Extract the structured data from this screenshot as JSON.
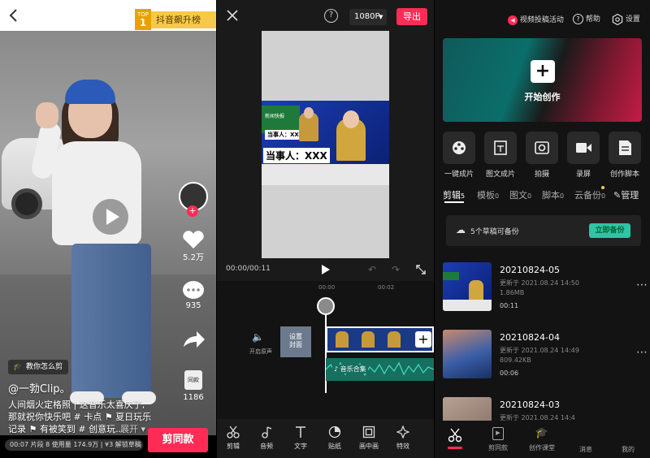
{
  "panel1": {
    "rank_badge": "抖音飙升榜",
    "rank_top": "TOP",
    "rank_number": "1",
    "likes": "5.2万",
    "comments": "935",
    "same_count": "1186",
    "same_label": "同款",
    "tutorial": "教你怎么剪",
    "author": "@一勃Clip。",
    "caption_line1": "人间烟火定格照 | 这音乐太喜庆了,",
    "caption_line2": "那就祝你快乐吧 # 卡点 ⚑ 夏日玩乐",
    "caption_line3": "记录 ⚑ 有被笑到 # 创意玩...",
    "expand": "展开",
    "stats": "00:07 片段 8 使用量 174.9万 | ¥3 解锁草稿",
    "cut_same": "剪同款"
  },
  "panel2": {
    "resolution": "1080P",
    "export": "导出",
    "time": "00:00/00:11",
    "ruler": [
      "00:00",
      "00:02"
    ],
    "news_banner": "新闻快报",
    "lower_third": "当事人：XXX",
    "lower_third_small": "当事人：XXX",
    "mute_label": "开启原声",
    "cover_label": "设置\n封面",
    "audio_label": "音乐合集",
    "tools": [
      "剪辑",
      "音频",
      "文字",
      "贴纸",
      "画中画",
      "特效"
    ]
  },
  "panel3": {
    "event": "视频投稿活动",
    "help": "帮助",
    "settings": "设置",
    "start": "开始创作",
    "quick": [
      "一键成片",
      "图文成片",
      "拍摄",
      "录屏",
      "创作脚本"
    ],
    "tabs": [
      {
        "label": "剪辑",
        "count": "5"
      },
      {
        "label": "模板",
        "count": "0"
      },
      {
        "label": "图文",
        "count": "0"
      },
      {
        "label": "脚本",
        "count": "0"
      },
      {
        "label": "云备份",
        "count": "0"
      }
    ],
    "manage": "管理",
    "backup_text": "5个草稿可备份",
    "backup_btn": "立即备份",
    "drafts": [
      {
        "title": "20210824-05",
        "updated": "更新于 2021.08.24 14:50",
        "size": "1.86MB",
        "duration": "00:11"
      },
      {
        "title": "20210824-04",
        "updated": "更新于 2021.08.24 14:49",
        "size": "809.42KB",
        "duration": "00:06"
      },
      {
        "title": "20210824-03",
        "updated": "更新于 2021.08.24 14:4",
        "size": "",
        "duration": ""
      }
    ],
    "nav": [
      "剪同款",
      "创作课堂",
      "消息",
      "我的"
    ],
    "accent": "#fe2c55",
    "teal": "#2ec4a5"
  }
}
